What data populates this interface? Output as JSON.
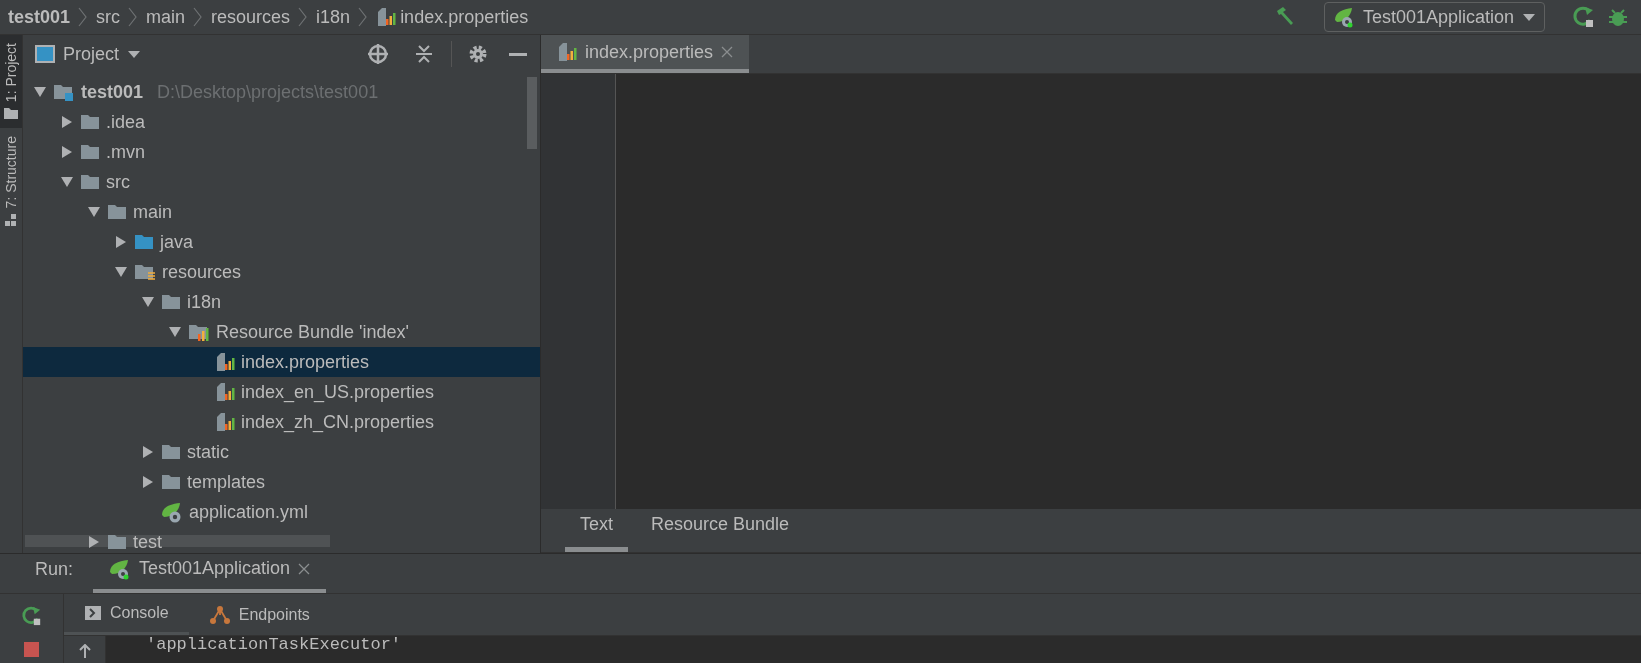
{
  "breadcrumbs": [
    {
      "label": "test001",
      "kind": "project"
    },
    {
      "label": "src",
      "kind": "folder"
    },
    {
      "label": "main",
      "kind": "folder"
    },
    {
      "label": "resources",
      "kind": "folder"
    },
    {
      "label": "i18n",
      "kind": "folder"
    },
    {
      "label": "index.properties",
      "kind": "properties"
    }
  ],
  "run_config": {
    "label": "Test001Application"
  },
  "tool_strip": [
    {
      "label": "1: Project",
      "selected": true
    },
    {
      "label": "7: Structure",
      "selected": false
    }
  ],
  "project_panel": {
    "title": "Project",
    "tree": [
      {
        "label": "test001",
        "path": "D:\\Desktop\\projects\\test001",
        "kind": "module",
        "expanded": true,
        "selected": false,
        "children": [
          {
            "label": ".idea",
            "kind": "folder",
            "expanded": false,
            "selected": false
          },
          {
            "label": ".mvn",
            "kind": "folder",
            "expanded": false,
            "selected": false
          },
          {
            "label": "src",
            "kind": "folder",
            "expanded": true,
            "selected": false,
            "children": [
              {
                "label": "main",
                "kind": "folder",
                "expanded": true,
                "selected": false,
                "children": [
                  {
                    "label": "java",
                    "kind": "source",
                    "expanded": false,
                    "selected": false
                  },
                  {
                    "label": "resources",
                    "kind": "resources",
                    "expanded": true,
                    "selected": false,
                    "children": [
                      {
                        "label": "i18n",
                        "kind": "folder",
                        "expanded": true,
                        "selected": false,
                        "children": [
                          {
                            "label": "Resource Bundle 'index'",
                            "kind": "bundle",
                            "expanded": true,
                            "selected": false,
                            "children": [
                              {
                                "label": "index.properties",
                                "kind": "properties",
                                "selected": true
                              },
                              {
                                "label": "index_en_US.properties",
                                "kind": "properties",
                                "selected": false
                              },
                              {
                                "label": "index_zh_CN.properties",
                                "kind": "properties",
                                "selected": false
                              }
                            ]
                          }
                        ]
                      },
                      {
                        "label": "static",
                        "kind": "folder",
                        "expanded": false,
                        "selected": false
                      },
                      {
                        "label": "templates",
                        "kind": "folder",
                        "expanded": false,
                        "selected": false
                      },
                      {
                        "label": "application.yml",
                        "kind": "spring",
                        "selected": false
                      }
                    ]
                  }
                ]
              },
              {
                "label": "test",
                "kind": "folder",
                "expanded": false,
                "selected": false
              }
            ]
          }
        ]
      }
    ]
  },
  "editor_tabs": [
    {
      "label": "index.properties",
      "selected": true
    }
  ],
  "editor_bottom_tabs": [
    {
      "label": "Text",
      "selected": true
    },
    {
      "label": "Resource Bundle",
      "selected": false
    }
  ],
  "run_panel": {
    "title": "Run:",
    "tabs": [
      {
        "label": "Test001Application",
        "selected": true
      }
    ],
    "subtabs": [
      {
        "label": "Console",
        "kind": "console"
      },
      {
        "label": "Endpoints",
        "kind": "endpoints"
      }
    ],
    "console_lines": [
      "'applicationTaskExecutor'"
    ]
  }
}
